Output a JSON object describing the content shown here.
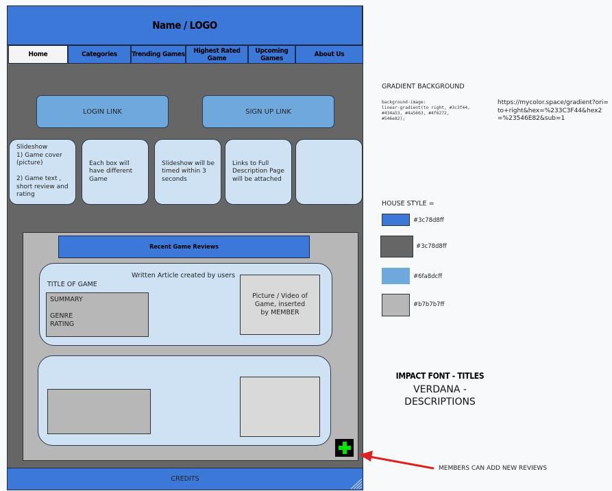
{
  "header": {
    "title": "Name / LOGO"
  },
  "nav": {
    "items": [
      {
        "label": "Home",
        "active": true
      },
      {
        "label": "Categories"
      },
      {
        "label": "Trending Games"
      },
      {
        "label": "Highest Rated Game"
      },
      {
        "label": "Upcoming Games"
      },
      {
        "label": "About Us"
      }
    ]
  },
  "auth": {
    "login_label": "LOGIN  LINK",
    "signup_label": "SIGN UP LINK"
  },
  "slides": [
    "Slideshow\n1) Game cover (picture)\n\n2) Game text , short review and rating",
    "Each box will have different Game",
    "Slideshow will be timed within 3 seconds",
    "Links to Full Description Page will be attached",
    ""
  ],
  "reviews": {
    "title": "Recent Game Reviews",
    "card1": {
      "caption": "Written Article created by users",
      "game_title": "TITLE OF GAME",
      "summary": "SUMMARY\n\nGENRE\nRATING",
      "media": "Picture / Video  of Game, inserted by MEMBER"
    }
  },
  "add_button": {
    "glyph": "+",
    "color": "#00ff00"
  },
  "footer": {
    "label": "CREDITS"
  },
  "notes": {
    "gradient_heading": "GRADIENT BACKGROUND",
    "gradient_code": "background-image:\nlinear-gradient(to right, #3c3f44,\n#434a53, #4a5663, #4f6272,\n#546e82);",
    "gradient_url": "https://mycolor.space/gradient?ori=to+right&hex=%233C3F44&hex2=%23546E82&sub=1",
    "house_style_heading": "HOUSE STYLE =",
    "swatches": [
      {
        "color": "#3c78d8",
        "label": "#3c78d8ff"
      },
      {
        "color": "#666666",
        "label": "#3c78d8ff"
      },
      {
        "color": "#6fa8dc",
        "label": "#6fa8dcff"
      },
      {
        "color": "#b7b7b7",
        "label": "#b7b7b7ff"
      }
    ],
    "font_title": "IMPACT FONT - TITLES",
    "font_desc": "VERDANA -\nDESCRIPTIONS",
    "members_note": "MEMBERS CAN ADD NEW REVIEWS",
    "arrow_color": "#e02020"
  }
}
